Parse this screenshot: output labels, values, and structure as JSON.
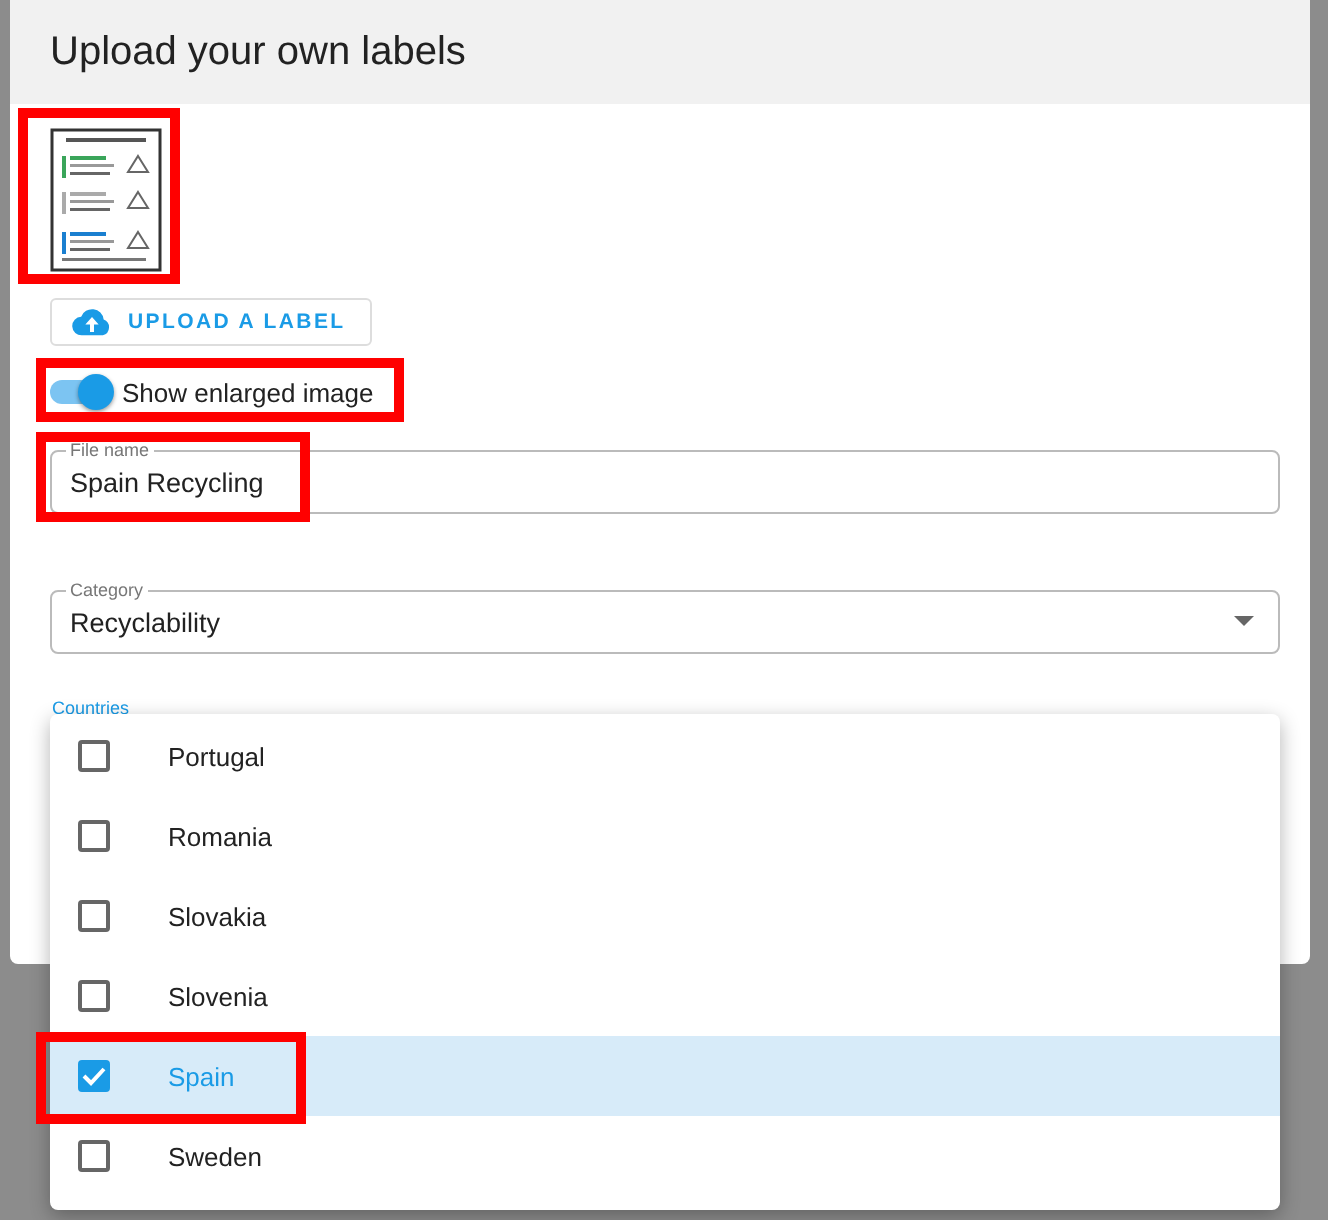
{
  "dialog": {
    "title": "Upload your own labels"
  },
  "label_preview": {
    "highlighted": true
  },
  "upload_button": {
    "label": "UPLOAD A LABEL"
  },
  "enlarge_switch": {
    "label": "Show enlarged image",
    "on": true,
    "highlighted": true
  },
  "file_name": {
    "label": "File name",
    "value": "Spain Recycling",
    "highlighted": true
  },
  "category": {
    "label": "Category",
    "value": "Recyclability"
  },
  "countries": {
    "label": "Countries",
    "options": [
      {
        "label": "Portugal",
        "checked": false,
        "selected": false,
        "highlighted": false
      },
      {
        "label": "Romania",
        "checked": false,
        "selected": false,
        "highlighted": false
      },
      {
        "label": "Slovakia",
        "checked": false,
        "selected": false,
        "highlighted": false
      },
      {
        "label": "Slovenia",
        "checked": false,
        "selected": false,
        "highlighted": false
      },
      {
        "label": "Spain",
        "checked": true,
        "selected": true,
        "highlighted": true
      },
      {
        "label": "Sweden",
        "checked": false,
        "selected": false,
        "highlighted": false
      }
    ]
  }
}
